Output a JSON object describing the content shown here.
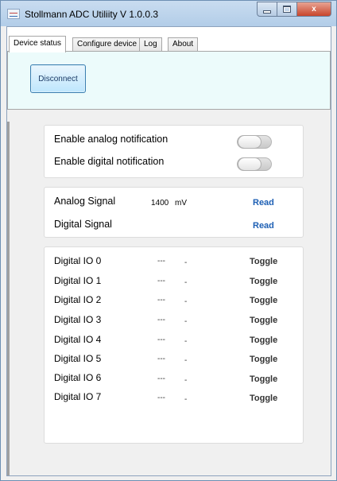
{
  "window": {
    "title": "Stollmann ADC  Utiliity V 1.0.0.3",
    "close_glyph": "x"
  },
  "tabs": [
    {
      "label": "Device status",
      "active": true
    },
    {
      "label": "Configure device",
      "active": false
    },
    {
      "label": "Log",
      "active": false
    },
    {
      "label": "About",
      "active": false
    }
  ],
  "connection": {
    "disconnect_label": "Disconnect"
  },
  "notifications": {
    "analog_label": "Enable analog notification",
    "analog_enabled": false,
    "digital_label": "Enable digital notification",
    "digital_enabled": false
  },
  "signals": {
    "analog": {
      "label": "Analog Signal",
      "value": "1400",
      "unit": "mV",
      "action": "Read"
    },
    "digital": {
      "label": "Digital Signal",
      "action": "Read"
    }
  },
  "digital_io": [
    {
      "label": "Digital IO 0",
      "v1": "---",
      "v2": "-",
      "action": "Toggle"
    },
    {
      "label": "Digital IO 1",
      "v1": "---",
      "v2": "-",
      "action": "Toggle"
    },
    {
      "label": "Digital IO 2",
      "v1": "---",
      "v2": "-",
      "action": "Toggle"
    },
    {
      "label": "Digital IO 3",
      "v1": "---",
      "v2": "-",
      "action": "Toggle"
    },
    {
      "label": "Digital IO 4",
      "v1": "---",
      "v2": "-",
      "action": "Toggle"
    },
    {
      "label": "Digital IO 5",
      "v1": "---",
      "v2": "-",
      "action": "Toggle"
    },
    {
      "label": "Digital IO 6",
      "v1": "---",
      "v2": "-",
      "action": "Toggle"
    },
    {
      "label": "Digital IO 7",
      "v1": "---",
      "v2": "-",
      "action": "Toggle"
    }
  ],
  "colors": {
    "read_link": "#1d5fb4",
    "panel_bg": "#ecfbfb"
  }
}
